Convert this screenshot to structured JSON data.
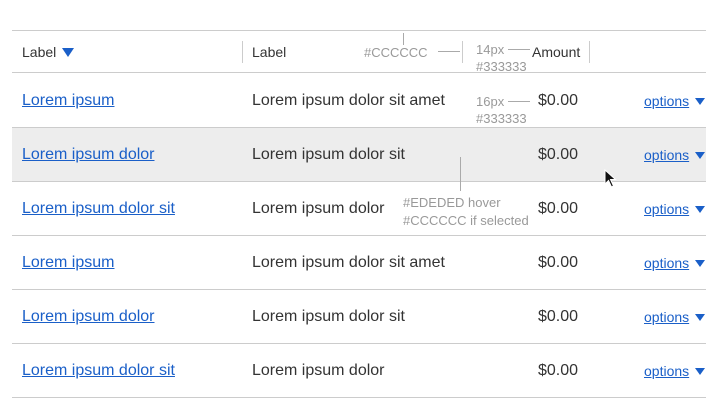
{
  "header": {
    "col1_label": "Label",
    "col2_label": "Label",
    "col3_label": "Amount"
  },
  "rows": [
    {
      "name": "Lorem ipsum",
      "description": "Lorem ipsum dolor sit amet",
      "amount": "$0.00",
      "options": "options",
      "state": "default"
    },
    {
      "name": "Lorem ipsum dolor",
      "description": "Lorem ipsum dolor sit",
      "amount": "$0.00",
      "options": "options",
      "state": "hover"
    },
    {
      "name": "Lorem ipsum dolor sit",
      "description": "Lorem ipsum dolor",
      "amount": "$0.00",
      "options": "options",
      "state": "default"
    },
    {
      "name": "Lorem ipsum",
      "description": "Lorem ipsum dolor sit amet",
      "amount": "$0.00",
      "options": "options",
      "state": "default"
    },
    {
      "name": "Lorem ipsum dolor",
      "description": "Lorem ipsum dolor sit",
      "amount": "$0.00",
      "options": "options",
      "state": "default"
    },
    {
      "name": "Lorem ipsum dolor sit",
      "description": "Lorem ipsum dolor",
      "amount": "$0.00",
      "options": "options",
      "state": "default"
    }
  ],
  "annotations": {
    "divider_color": "#CCCCCC",
    "header_size": "14px",
    "header_color": "#333333",
    "body_size": "16px",
    "body_color": "#333333",
    "hover_note": "#EDEDED hover",
    "selected_note": "#CCCCCC if selected"
  },
  "colors": {
    "link": "#1a5fc8",
    "text": "#333333",
    "divider": "#cccccc",
    "hover_bg": "#ededed"
  },
  "icons": {
    "sort": "sort-descending-icon",
    "options": "chevron-down-icon",
    "cursor": "mouse-pointer-icon"
  }
}
